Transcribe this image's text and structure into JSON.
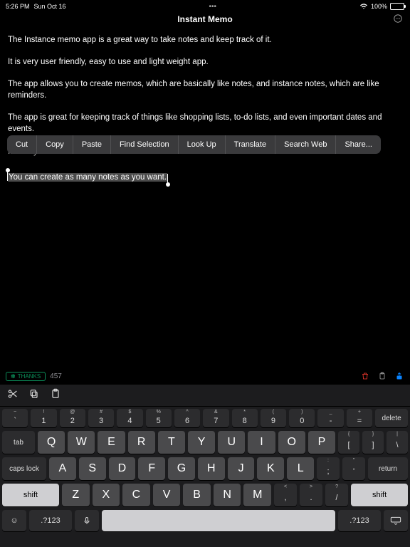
{
  "status": {
    "time": "5:26 PM",
    "date": "Sun Oct 16",
    "battery_pct": "100%"
  },
  "header": {
    "title": "Instant Memo"
  },
  "memo": {
    "p1": "The Instance memo app is a great way to take notes and keep track of it.",
    "p2": "It is very user friendly, easy to use and light weight app.",
    "p3": "The app allows you to create memos, which are basically like notes, and instance notes, which are like reminders.",
    "p4": "The app is great for keeping track of things like shopping lists, to-do lists, and even important dates and events.",
    "p5": "It's easy to use and has a clean interface.",
    "p6_selected": "You can create as many notes as you want."
  },
  "context_menu": {
    "cut": "Cut",
    "copy": "Copy",
    "paste": "Paste",
    "find": "Find Selection",
    "lookup": "Look Up",
    "translate": "Translate",
    "search": "Search Web",
    "share": "Share..."
  },
  "footer": {
    "thanks_label": "THANKS",
    "count": "457"
  },
  "keyboard": {
    "row1": [
      {
        "sub": "~",
        "main": "`"
      },
      {
        "sub": "!",
        "main": "1"
      },
      {
        "sub": "@",
        "main": "2"
      },
      {
        "sub": "#",
        "main": "3"
      },
      {
        "sub": "$",
        "main": "4"
      },
      {
        "sub": "%",
        "main": "5"
      },
      {
        "sub": "^",
        "main": "6"
      },
      {
        "sub": "&",
        "main": "7"
      },
      {
        "sub": "*",
        "main": "8"
      },
      {
        "sub": "(",
        "main": "9"
      },
      {
        "sub": ")",
        "main": "0"
      },
      {
        "sub": "_",
        "main": "-"
      },
      {
        "sub": "+",
        "main": "="
      }
    ],
    "delete": "delete",
    "tab": "tab",
    "row2": [
      "Q",
      "W",
      "E",
      "R",
      "T",
      "Y",
      "U",
      "I",
      "O",
      "P"
    ],
    "row2_brackets": [
      {
        "sub": "{",
        "main": "["
      },
      {
        "sub": "}",
        "main": "]"
      },
      {
        "sub": "|",
        "main": "\\"
      }
    ],
    "caps": "caps lock",
    "row3": [
      "A",
      "S",
      "D",
      "F",
      "G",
      "H",
      "J",
      "K",
      "L"
    ],
    "row3_punc": [
      {
        "sub": ":",
        "main": ";"
      },
      {
        "sub": "\"",
        "main": "'"
      }
    ],
    "return": "return",
    "shift": "shift",
    "row4": [
      "Z",
      "X",
      "C",
      "V",
      "B",
      "N",
      "M"
    ],
    "row4_punc": [
      {
        "sub": "<",
        "main": ","
      },
      {
        "sub": ">",
        "main": "."
      },
      {
        "sub": "?",
        "main": "/"
      }
    ],
    "num_mode": ".?123"
  }
}
